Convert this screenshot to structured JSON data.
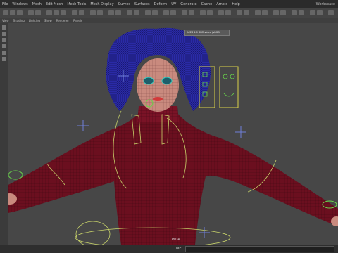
{
  "menubar": {
    "items": [
      "File",
      "Windows",
      "Mesh",
      "Edit Mesh",
      "Mesh Tools",
      "Mesh Display",
      "Curves",
      "Surfaces",
      "Deform",
      "UV",
      "Generate",
      "Cache",
      "Arnold",
      "Help"
    ],
    "app_title": "Workspace"
  },
  "viewbar": {
    "items": [
      "View",
      "Shading",
      "Lighting",
      "Show",
      "Renderer",
      "Panels"
    ]
  },
  "viewport": {
    "hud_text": "ACES 1.0 SDR-video (sRGB)",
    "camera_label": "persp"
  },
  "statusbar": {
    "mel_label": "MEL"
  },
  "colors": {
    "body_mesh": "#6b0f1f",
    "hair": "#2a2aa6",
    "skin": "#c98a7e",
    "nurbs_control": "#c9d46a",
    "locator": "#6f7fd8",
    "face_control": "#d8d04a",
    "ik_green": "#6ad84a"
  }
}
